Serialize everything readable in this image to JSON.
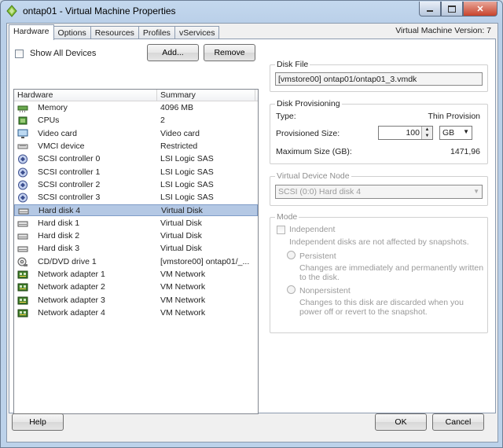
{
  "window": {
    "title": "ontap01 - Virtual Machine Properties"
  },
  "tabs": [
    "Hardware",
    "Options",
    "Resources",
    "Profiles",
    "vServices"
  ],
  "vm_version": "Virtual Machine Version: 7",
  "toolbar": {
    "show_all_devices": "Show All Devices",
    "add": "Add...",
    "remove": "Remove"
  },
  "hardware_table": {
    "headers": [
      "Hardware",
      "Summary"
    ],
    "rows": [
      {
        "name": "Memory",
        "summary": "4096 MB",
        "icon": "memory-icon"
      },
      {
        "name": "CPUs",
        "summary": "2",
        "icon": "cpu-icon"
      },
      {
        "name": "Video card",
        "summary": "Video card",
        "icon": "monitor-icon"
      },
      {
        "name": "VMCI device",
        "summary": "Restricted",
        "icon": "vmci-icon"
      },
      {
        "name": "SCSI controller 0",
        "summary": "LSI Logic SAS",
        "icon": "scsi-controller-icon"
      },
      {
        "name": "SCSI controller 1",
        "summary": "LSI Logic SAS",
        "icon": "scsi-controller-icon"
      },
      {
        "name": "SCSI controller 2",
        "summary": "LSI Logic SAS",
        "icon": "scsi-controller-icon"
      },
      {
        "name": "SCSI controller 3",
        "summary": "LSI Logic SAS",
        "icon": "scsi-controller-icon"
      },
      {
        "name": "Hard disk 4",
        "summary": "Virtual Disk",
        "icon": "hard-disk-icon",
        "selected": true
      },
      {
        "name": "Hard disk 1",
        "summary": "Virtual Disk",
        "icon": "hard-disk-icon"
      },
      {
        "name": "Hard disk 2",
        "summary": "Virtual Disk",
        "icon": "hard-disk-icon"
      },
      {
        "name": "Hard disk 3",
        "summary": "Virtual Disk",
        "icon": "hard-disk-icon"
      },
      {
        "name": "CD/DVD drive 1",
        "summary": "[vmstore00] ontap01/_...",
        "icon": "cd-dvd-icon"
      },
      {
        "name": "Network adapter 1",
        "summary": "VM Network",
        "icon": "network-adapter-icon"
      },
      {
        "name": "Network adapter 2",
        "summary": "VM Network",
        "icon": "network-adapter-icon"
      },
      {
        "name": "Network adapter 3",
        "summary": "VM Network",
        "icon": "network-adapter-icon"
      },
      {
        "name": "Network adapter 4",
        "summary": "VM Network",
        "icon": "network-adapter-icon"
      }
    ]
  },
  "disk_file": {
    "title": "Disk File",
    "value": "[vmstore00] ontap01/ontap01_3.vmdk"
  },
  "disk_provisioning": {
    "title": "Disk Provisioning",
    "type_label": "Type:",
    "type_value": "Thin Provision",
    "size_label": "Provisioned Size:",
    "size_value": "100",
    "unit": "GB",
    "max_label": "Maximum Size (GB):",
    "max_value": "1471,96"
  },
  "virtual_device_node": {
    "title": "Virtual Device Node",
    "value": "SCSI (0:0) Hard disk 4"
  },
  "mode": {
    "title": "Mode",
    "independent": "Independent",
    "independent_desc": "Independent disks are not affected by snapshots.",
    "persistent": "Persistent",
    "persistent_desc": "Changes are immediately and permanently written to the disk.",
    "nonpersistent": "Nonpersistent",
    "nonpersistent_desc": "Changes to this disk are discarded when you power off or revert to the snapshot."
  },
  "footer": {
    "help": "Help",
    "ok": "OK",
    "cancel": "Cancel"
  }
}
